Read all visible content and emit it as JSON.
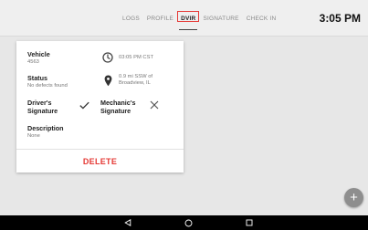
{
  "tabs": [
    {
      "label": "LOGS",
      "active": false
    },
    {
      "label": "PROFILE",
      "active": false
    },
    {
      "label": "DVIR",
      "active": true
    },
    {
      "label": "SIGNATURE",
      "active": false
    },
    {
      "label": "CHECK IN",
      "active": false
    }
  ],
  "time": "3:05 PM",
  "card": {
    "vehicle": {
      "label": "Vehicle",
      "value": "4563"
    },
    "inspection_time": "03:05 PM CST",
    "status": {
      "label": "Status",
      "value": "No defects found"
    },
    "location": {
      "line1": "0.9 mi SSW of",
      "line2": "Broadview, IL"
    },
    "driver_signature": {
      "line1": "Driver's",
      "line2": "Signature",
      "signed": true
    },
    "mechanic_signature": {
      "line1": "Mechanic's",
      "line2": "Signature",
      "signed": false
    },
    "description": {
      "label": "Description",
      "value": "None"
    },
    "delete_label": "DELETE"
  },
  "fab_label": "+",
  "colors": {
    "accent": "#e53935",
    "fab": "#8e8e8e",
    "navbar": "#000000"
  },
  "icons": [
    "clock-icon",
    "location-pin-icon",
    "checkmark-icon",
    "close-icon",
    "back-icon",
    "home-icon",
    "recents-icon"
  ]
}
